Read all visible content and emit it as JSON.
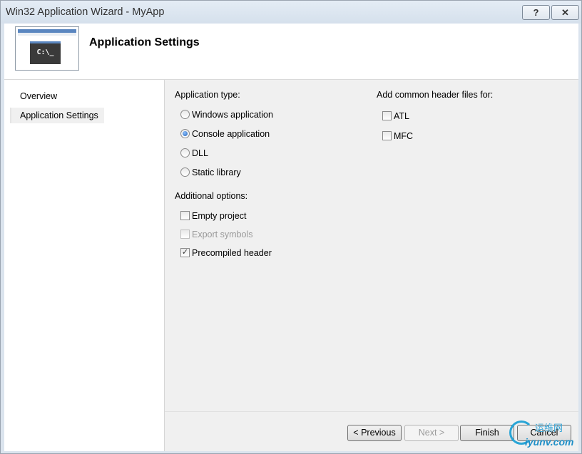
{
  "window": {
    "title": "Win32 Application Wizard - MyApp",
    "help_label": "?",
    "close_label": "✕"
  },
  "header": {
    "title": "Application Settings",
    "image_text": "C:\\_"
  },
  "nav": {
    "items": [
      {
        "label": "Overview"
      },
      {
        "label": "Application Settings"
      }
    ]
  },
  "app_type": {
    "label": "Application type:",
    "options": [
      {
        "label": "Windows application",
        "selected": false
      },
      {
        "label": "Console application",
        "selected": true
      },
      {
        "label": "DLL",
        "selected": false
      },
      {
        "label": "Static library",
        "selected": false
      }
    ]
  },
  "additional": {
    "label": "Additional options:",
    "options": [
      {
        "label": "Empty project",
        "checked": false,
        "enabled": true
      },
      {
        "label": "Export symbols",
        "checked": false,
        "enabled": false
      },
      {
        "label": "Precompiled header",
        "checked": true,
        "enabled": true
      }
    ]
  },
  "headers": {
    "label": "Add common header files for:",
    "options": [
      {
        "label": "ATL",
        "checked": false
      },
      {
        "label": "MFC",
        "checked": false
      }
    ]
  },
  "buttons": {
    "previous": "< Previous",
    "next": "Next >",
    "finish": "Finish",
    "cancel": "Cancel"
  },
  "watermark": {
    "cn": "运维网",
    "en": "iyunv.com"
  },
  "colors": {
    "title_bar": "#dbe4ee",
    "dialog_bg": "#f0f0f0",
    "radio_selected": "#1f5fb5"
  }
}
